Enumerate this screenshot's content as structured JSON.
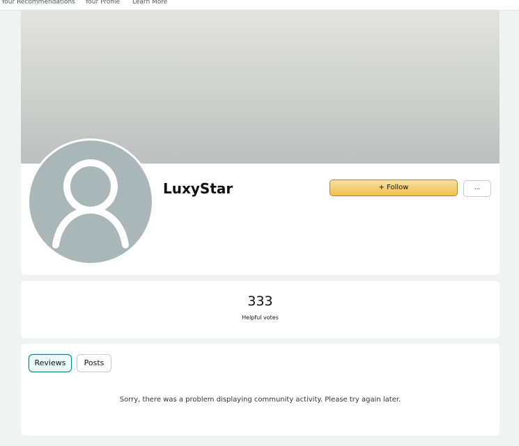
{
  "nav": {
    "items": [
      "Your Recommendations",
      "Your Profile",
      "Learn More"
    ]
  },
  "profile": {
    "username": "LuxyStar",
    "follow_label": "+ Follow",
    "more_label": "..."
  },
  "stats": {
    "helpful_votes": "333",
    "helpful_votes_label": "Helpful votes"
  },
  "activity": {
    "tabs": [
      "Reviews",
      "Posts"
    ],
    "selected_tab": "Reviews",
    "message": "Sorry, there was a problem displaying community activity. Please try again later."
  },
  "colors": {
    "follow_button": "#f0c14b",
    "selected_tab_border": "#008296",
    "avatar_bg": "#aab7b8"
  },
  "icons": {
    "avatar": "default-user-icon"
  }
}
